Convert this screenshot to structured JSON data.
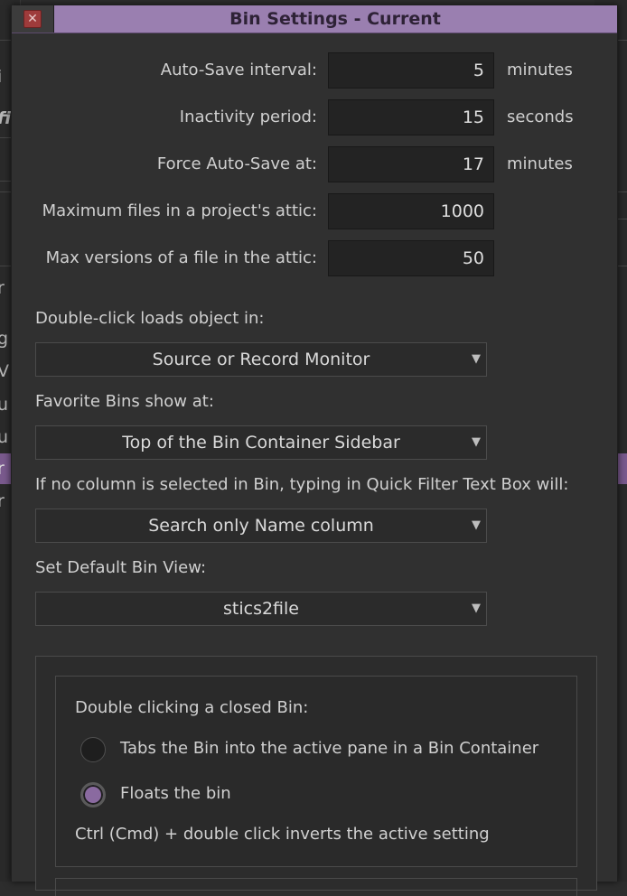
{
  "window": {
    "title": "Bin Settings - Current",
    "close_glyph": "✕"
  },
  "settings": [
    {
      "label": "Auto-Save interval:",
      "value": "5",
      "unit": "minutes"
    },
    {
      "label": "Inactivity period:",
      "value": "15",
      "unit": "seconds"
    },
    {
      "label": "Force Auto-Save at:",
      "value": "17",
      "unit": "minutes"
    },
    {
      "label": "Maximum files in a project's attic:",
      "value": "1000",
      "unit": ""
    },
    {
      "label": "Max versions of a file in the attic:",
      "value": "50",
      "unit": ""
    }
  ],
  "double_click": {
    "label": "Double-click loads object in:",
    "selected": "Source or Record Monitor"
  },
  "favorite_bins": {
    "label": "Favorite Bins show at:",
    "selected": "Top of the Bin Container Sidebar"
  },
  "quick_filter": {
    "label": "If no column is selected in Bin, typing in Quick Filter Text Box will:",
    "selected": "Search only Name column"
  },
  "default_view": {
    "label": "Set Default Bin View:",
    "selected": "stics2file"
  },
  "closed_bin": {
    "heading": "Double clicking a closed Bin:",
    "options": [
      {
        "label": "Tabs the Bin into the active pane in a Bin Container",
        "selected": false
      },
      {
        "label": "Floats the bin",
        "selected": true
      }
    ],
    "note": "Ctrl (Cmd) + double click inverts the active setting"
  },
  "background": {
    "left_fragments": [
      "i",
      "fi",
      "r",
      "g",
      "V",
      "u",
      "u",
      "r",
      "r"
    ]
  },
  "colors": {
    "accent": "#9a7fb0",
    "radio_selected": "#8a6aa0",
    "close": "#9e3b3b"
  },
  "icons": {
    "close": "close-icon",
    "dropdown": "triangle-down-icon"
  }
}
